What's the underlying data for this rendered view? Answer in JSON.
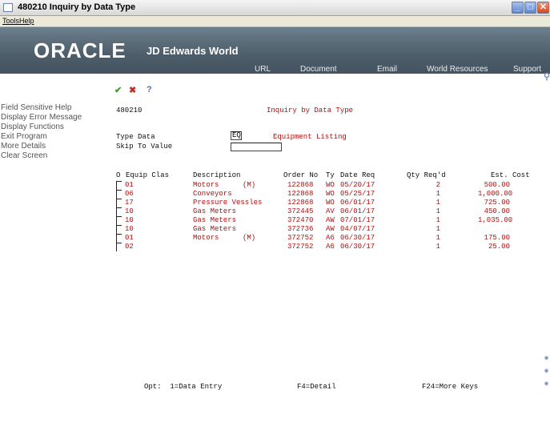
{
  "window": {
    "title": "480210   Inquiry by Data Type"
  },
  "menubar": {
    "items": [
      "Tools",
      "Help"
    ]
  },
  "banner": {
    "logo": "ORACLE",
    "product": "JD Edwards World",
    "nav": [
      "URL",
      "Document",
      "Email",
      "World Resources",
      "Support"
    ]
  },
  "leftpane": {
    "items": [
      "Field Sensitive Help",
      "Display Error Message",
      "Display Functions",
      "Exit Program",
      "More Details",
      "Clear Screen"
    ]
  },
  "toolbar": {
    "ok": "✔",
    "cancel": "✖",
    "help": "?"
  },
  "form": {
    "program_id": "480210",
    "screen_title": "Inquiry by Data Type",
    "type_data_label": "Type Data",
    "type_data_value": "EQ",
    "type_data_desc": "Equipment Listing",
    "skip_label": "Skip To Value",
    "skip_value": "",
    "columns": {
      "o": "O",
      "equip_clas": "Equip Clas",
      "description": "Description",
      "order_no": "Order No",
      "ty": "Ty",
      "date_req": "Date Req",
      "qty": "Qty Req'd",
      "cost": "Est. Cost"
    },
    "rows": [
      {
        "clas": "01",
        "desc": "Motors",
        "flag": "(M)",
        "order": "122868",
        "ty": "WO",
        "date": "05/20/17",
        "qty": "2",
        "cost": "500.00"
      },
      {
        "clas": "06",
        "desc": "Conveyors",
        "flag": "",
        "order": "122868",
        "ty": "WO",
        "date": "05/25/17",
        "qty": "1",
        "cost": "1,000.00"
      },
      {
        "clas": "17",
        "desc": "Pressure Vessles",
        "flag": "",
        "order": "122868",
        "ty": "WO",
        "date": "06/01/17",
        "qty": "1",
        "cost": "725.00"
      },
      {
        "clas": "10",
        "desc": "Gas Meters",
        "flag": "",
        "order": "372445",
        "ty": "AV",
        "date": "06/01/17",
        "qty": "1",
        "cost": "450.00"
      },
      {
        "clas": "10",
        "desc": "Gas Meters",
        "flag": "",
        "order": "372470",
        "ty": "AW",
        "date": "07/01/17",
        "qty": "1",
        "cost": "1,035.00"
      },
      {
        "clas": "10",
        "desc": "Gas Meters",
        "flag": "",
        "order": "372736",
        "ty": "AW",
        "date": "04/07/17",
        "qty": "1",
        "cost": ""
      },
      {
        "clas": "01",
        "desc": "Motors",
        "flag": "(M)",
        "order": "372752",
        "ty": "A6",
        "date": "06/30/17",
        "qty": "1",
        "cost": "175.00"
      },
      {
        "clas": "02",
        "desc": "",
        "flag": "",
        "order": "372752",
        "ty": "A6",
        "date": "06/30/17",
        "qty": "1",
        "cost": "25.00"
      }
    ],
    "footer": {
      "opt": "Opt:  1=Data Entry",
      "f4": "F4=Detail",
      "f24": "F24=More Keys"
    }
  },
  "colors": {
    "field_text": "#b01010",
    "banner": "#55656f"
  }
}
